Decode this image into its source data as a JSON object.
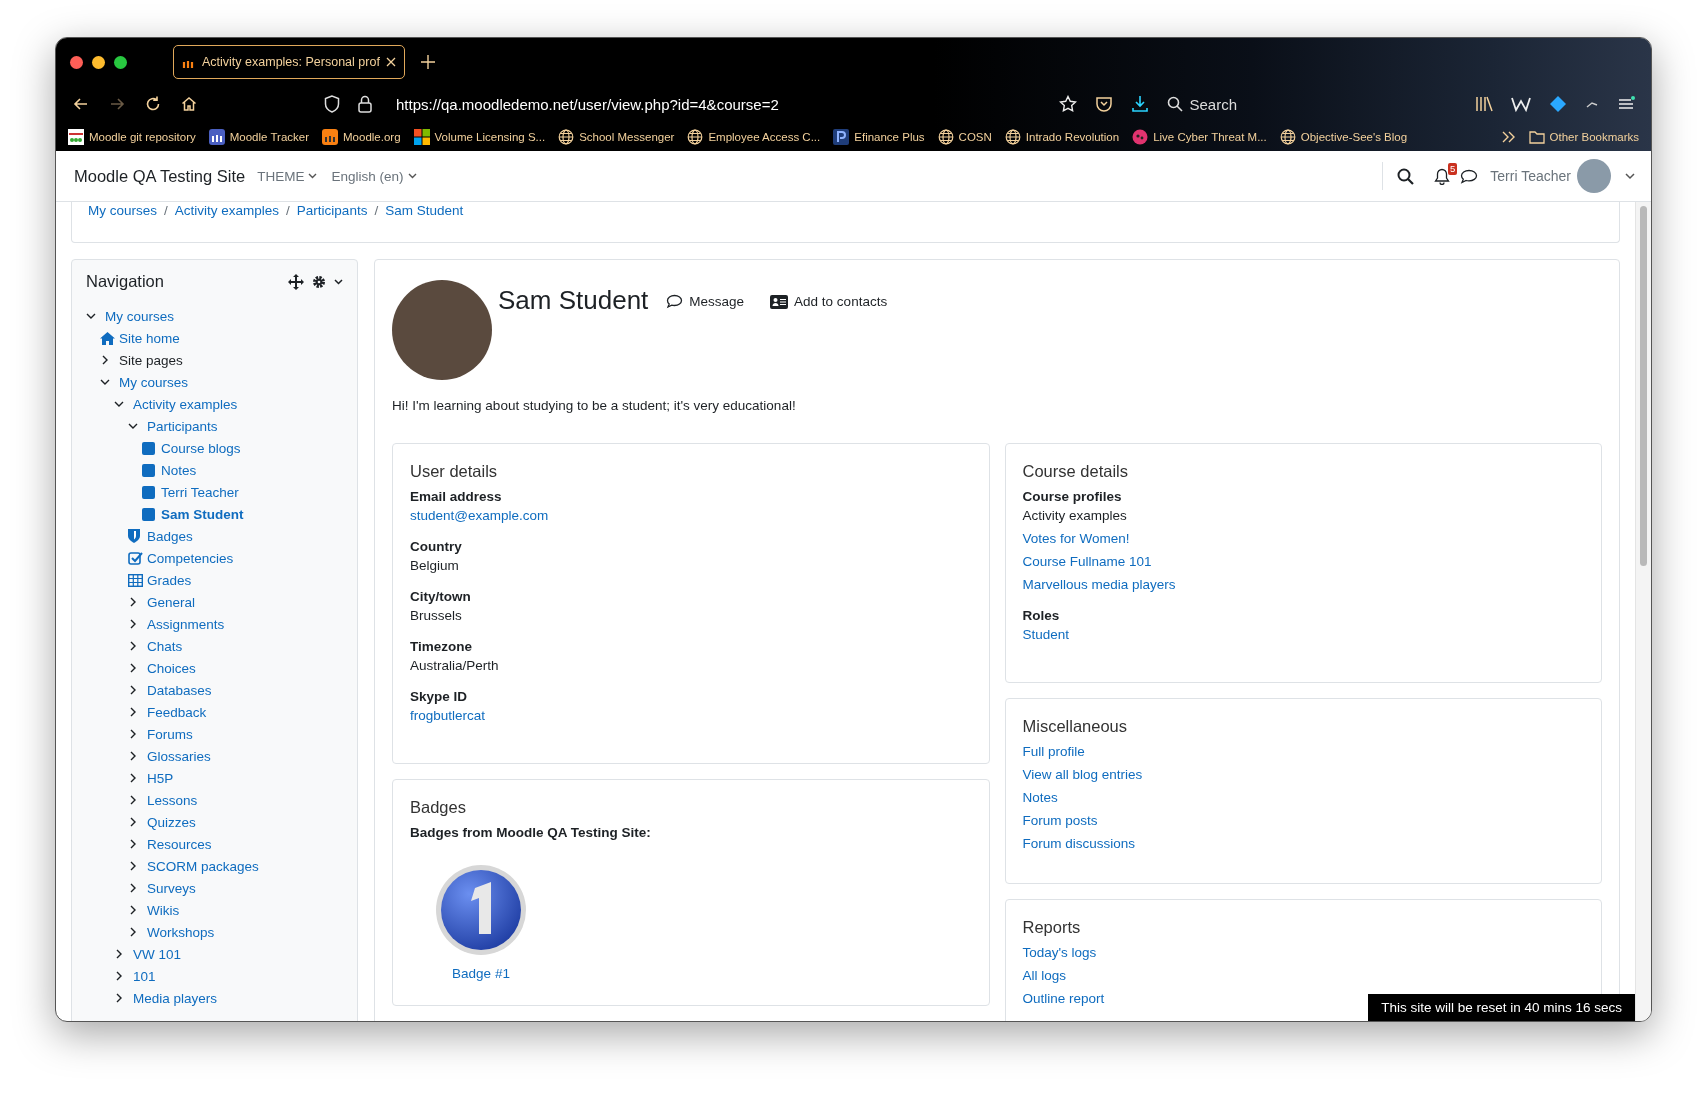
{
  "browser": {
    "tab": {
      "title": "Activity examples: Personal prof",
      "selected": true
    },
    "nav_buttons": [
      {
        "kind": "back",
        "disabled": false
      },
      {
        "kind": "forward",
        "disabled": true
      },
      {
        "kind": "reload",
        "disabled": false
      },
      {
        "kind": "home",
        "disabled": false
      }
    ],
    "url": "https://qa.moodledemo.net/user/view.php?id=4&course=2",
    "search": "Search",
    "bookmarks": [
      {
        "label": "Moodle git repository",
        "kind": "grid"
      },
      {
        "label": "Moodle Tracker",
        "kind": "tracker"
      },
      {
        "label": "Moodle.org",
        "kind": "moodle"
      },
      {
        "label": "Volume Licensing S...",
        "kind": "windows"
      },
      {
        "label": "School Messenger",
        "kind": "globe"
      },
      {
        "label": "Employee Access C...",
        "kind": "globe"
      },
      {
        "label": "Efinance Plus",
        "kind": "paypal"
      },
      {
        "label": "COSN",
        "kind": "globe"
      },
      {
        "label": "Intrado Revolution",
        "kind": "globe"
      },
      {
        "label": "Live Cyber Threat M...",
        "kind": "threat"
      },
      {
        "label": "Objective-See's Blog",
        "kind": "globe"
      }
    ],
    "other_bookmarks": "Other Bookmarks"
  },
  "site": {
    "name": "Moodle QA Testing Site",
    "theme": "THEME",
    "language": "English (en)",
    "notifications": "5",
    "user": "Terri Teacher"
  },
  "breadcrumb": [
    {
      "kind": "link",
      "text": "My courses"
    },
    {
      "kind": "separator",
      "text": "/"
    },
    {
      "kind": "link",
      "text": "Activity examples"
    },
    {
      "kind": "separator",
      "text": "/"
    },
    {
      "kind": "link",
      "text": "Participants"
    },
    {
      "kind": "separator",
      "text": "/"
    },
    {
      "kind": "link",
      "text": "Sam Student"
    }
  ],
  "navigation": {
    "title": "Navigation",
    "tree": [
      {
        "label": "My courses",
        "kind": "branch",
        "expanded": true,
        "link": true,
        "selected": false,
        "children": [
          {
            "label": "Site home",
            "kind": "home",
            "link": true,
            "selected": false
          },
          {
            "label": "Site pages",
            "kind": "branch",
            "expanded": false,
            "link": false,
            "selected": false
          },
          {
            "label": "My courses",
            "kind": "branch",
            "expanded": true,
            "link": true,
            "selected": false,
            "children": [
              {
                "label": "Activity examples",
                "kind": "branch",
                "expanded": true,
                "link": true,
                "selected": false,
                "children": [
                  {
                    "label": "Participants",
                    "kind": "branch",
                    "expanded": true,
                    "link": true,
                    "selected": false,
                    "children": [
                      {
                        "label": "Course blogs",
                        "kind": "leaf",
                        "link": true,
                        "selected": false
                      },
                      {
                        "label": "Notes",
                        "kind": "leaf",
                        "link": true,
                        "selected": false
                      },
                      {
                        "label": "Terri Teacher",
                        "kind": "leaf",
                        "link": true,
                        "selected": false
                      },
                      {
                        "label": "Sam Student",
                        "kind": "leaf",
                        "link": true,
                        "selected": true
                      }
                    ]
                  },
                  {
                    "label": "Badges",
                    "kind": "badge",
                    "link": true,
                    "selected": false
                  },
                  {
                    "label": "Competencies",
                    "kind": "competency",
                    "link": true,
                    "selected": false
                  },
                  {
                    "label": "Grades",
                    "kind": "grades",
                    "link": true,
                    "selected": false
                  },
                  {
                    "label": "General",
                    "kind": "branch",
                    "expanded": false,
                    "link": true,
                    "selected": false
                  },
                  {
                    "label": "Assignments",
                    "kind": "branch",
                    "expanded": false,
                    "link": true,
                    "selected": false
                  },
                  {
                    "label": "Chats",
                    "kind": "branch",
                    "expanded": false,
                    "link": true,
                    "selected": false
                  },
                  {
                    "label": "Choices",
                    "kind": "branch",
                    "expanded": false,
                    "link": true,
                    "selected": false
                  },
                  {
                    "label": "Databases",
                    "kind": "branch",
                    "expanded": false,
                    "link": true,
                    "selected": false
                  },
                  {
                    "label": "Feedback",
                    "kind": "branch",
                    "expanded": false,
                    "link": true,
                    "selected": false
                  },
                  {
                    "label": "Forums",
                    "kind": "branch",
                    "expanded": false,
                    "link": true,
                    "selected": false
                  },
                  {
                    "label": "Glossaries",
                    "kind": "branch",
                    "expanded": false,
                    "link": true,
                    "selected": false
                  },
                  {
                    "label": "H5P",
                    "kind": "branch",
                    "expanded": false,
                    "link": true,
                    "selected": false
                  },
                  {
                    "label": "Lessons",
                    "kind": "branch",
                    "expanded": false,
                    "link": true,
                    "selected": false
                  },
                  {
                    "label": "Quizzes",
                    "kind": "branch",
                    "expanded": false,
                    "link": true,
                    "selected": false
                  },
                  {
                    "label": "Resources",
                    "kind": "branch",
                    "expanded": false,
                    "link": true,
                    "selected": false
                  },
                  {
                    "label": "SCORM packages",
                    "kind": "branch",
                    "expanded": false,
                    "link": true,
                    "selected": false
                  },
                  {
                    "label": "Surveys",
                    "kind": "branch",
                    "expanded": false,
                    "link": true,
                    "selected": false
                  },
                  {
                    "label": "Wikis",
                    "kind": "branch",
                    "expanded": false,
                    "link": true,
                    "selected": false
                  },
                  {
                    "label": "Workshops",
                    "kind": "branch",
                    "expanded": false,
                    "link": true,
                    "selected": false
                  }
                ]
              },
              {
                "label": "VW 101",
                "kind": "branch",
                "expanded": false,
                "link": true,
                "selected": false
              },
              {
                "label": "101",
                "kind": "branch",
                "expanded": false,
                "link": true,
                "selected": false
              },
              {
                "label": "Media players",
                "kind": "branch",
                "expanded": false,
                "link": true,
                "selected": false
              }
            ]
          }
        ]
      }
    ]
  },
  "profile": {
    "name": "Sam Student",
    "actions": [
      {
        "label": "Message",
        "kind": "message"
      },
      {
        "label": "Add to contacts",
        "kind": "contact"
      }
    ],
    "description": "Hi! I'm learning about studying to be a student; it's very educational!",
    "columns": [
      [
        {
          "title": "User details",
          "kind": "groups",
          "groups": [
            {
              "label": "Email address",
              "values": [
                {
                  "text": "student@example.com",
                  "link": true
                }
              ]
            },
            {
              "label": "Country",
              "values": [
                {
                  "text": "Belgium",
                  "link": false
                }
              ]
            },
            {
              "label": "City/town",
              "values": [
                {
                  "text": "Brussels",
                  "link": false
                }
              ]
            },
            {
              "label": "Timezone",
              "values": [
                {
                  "text": "Australia/Perth",
                  "link": false
                }
              ]
            },
            {
              "label": "Skype ID",
              "values": [
                {
                  "text": "frogbutlercat",
                  "link": true
                }
              ]
            }
          ]
        },
        {
          "title": "Badges",
          "kind": "badges",
          "label": "Badges from Moodle QA Testing Site:",
          "badges": [
            {
              "name": "Badge #1"
            }
          ]
        }
      ],
      [
        {
          "title": "Course details",
          "kind": "groups",
          "groups": [
            {
              "label": "Course profiles",
              "values": [
                {
                  "text": "Activity examples",
                  "link": false
                },
                {
                  "text": "Votes for Women!",
                  "link": true
                },
                {
                  "text": "Course Fullname 101",
                  "link": true
                },
                {
                  "text": "Marvellous media players",
                  "link": true
                }
              ]
            },
            {
              "label": "Roles",
              "values": [
                {
                  "text": "Student",
                  "link": true
                }
              ]
            }
          ]
        },
        {
          "title": "Miscellaneous",
          "kind": "links",
          "values": [
            {
              "text": "Full profile",
              "link": true
            },
            {
              "text": "View all blog entries",
              "link": true
            },
            {
              "text": "Notes",
              "link": true
            },
            {
              "text": "Forum posts",
              "link": true
            },
            {
              "text": "Forum discussions",
              "link": true
            }
          ]
        },
        {
          "title": "Reports",
          "kind": "links",
          "values": [
            {
              "text": "Today's logs",
              "link": true
            },
            {
              "text": "All logs",
              "link": true
            },
            {
              "text": "Outline report",
              "link": true
            }
          ]
        }
      ]
    ]
  },
  "notice": "This site will be reset in 40 mins 16 secs"
}
